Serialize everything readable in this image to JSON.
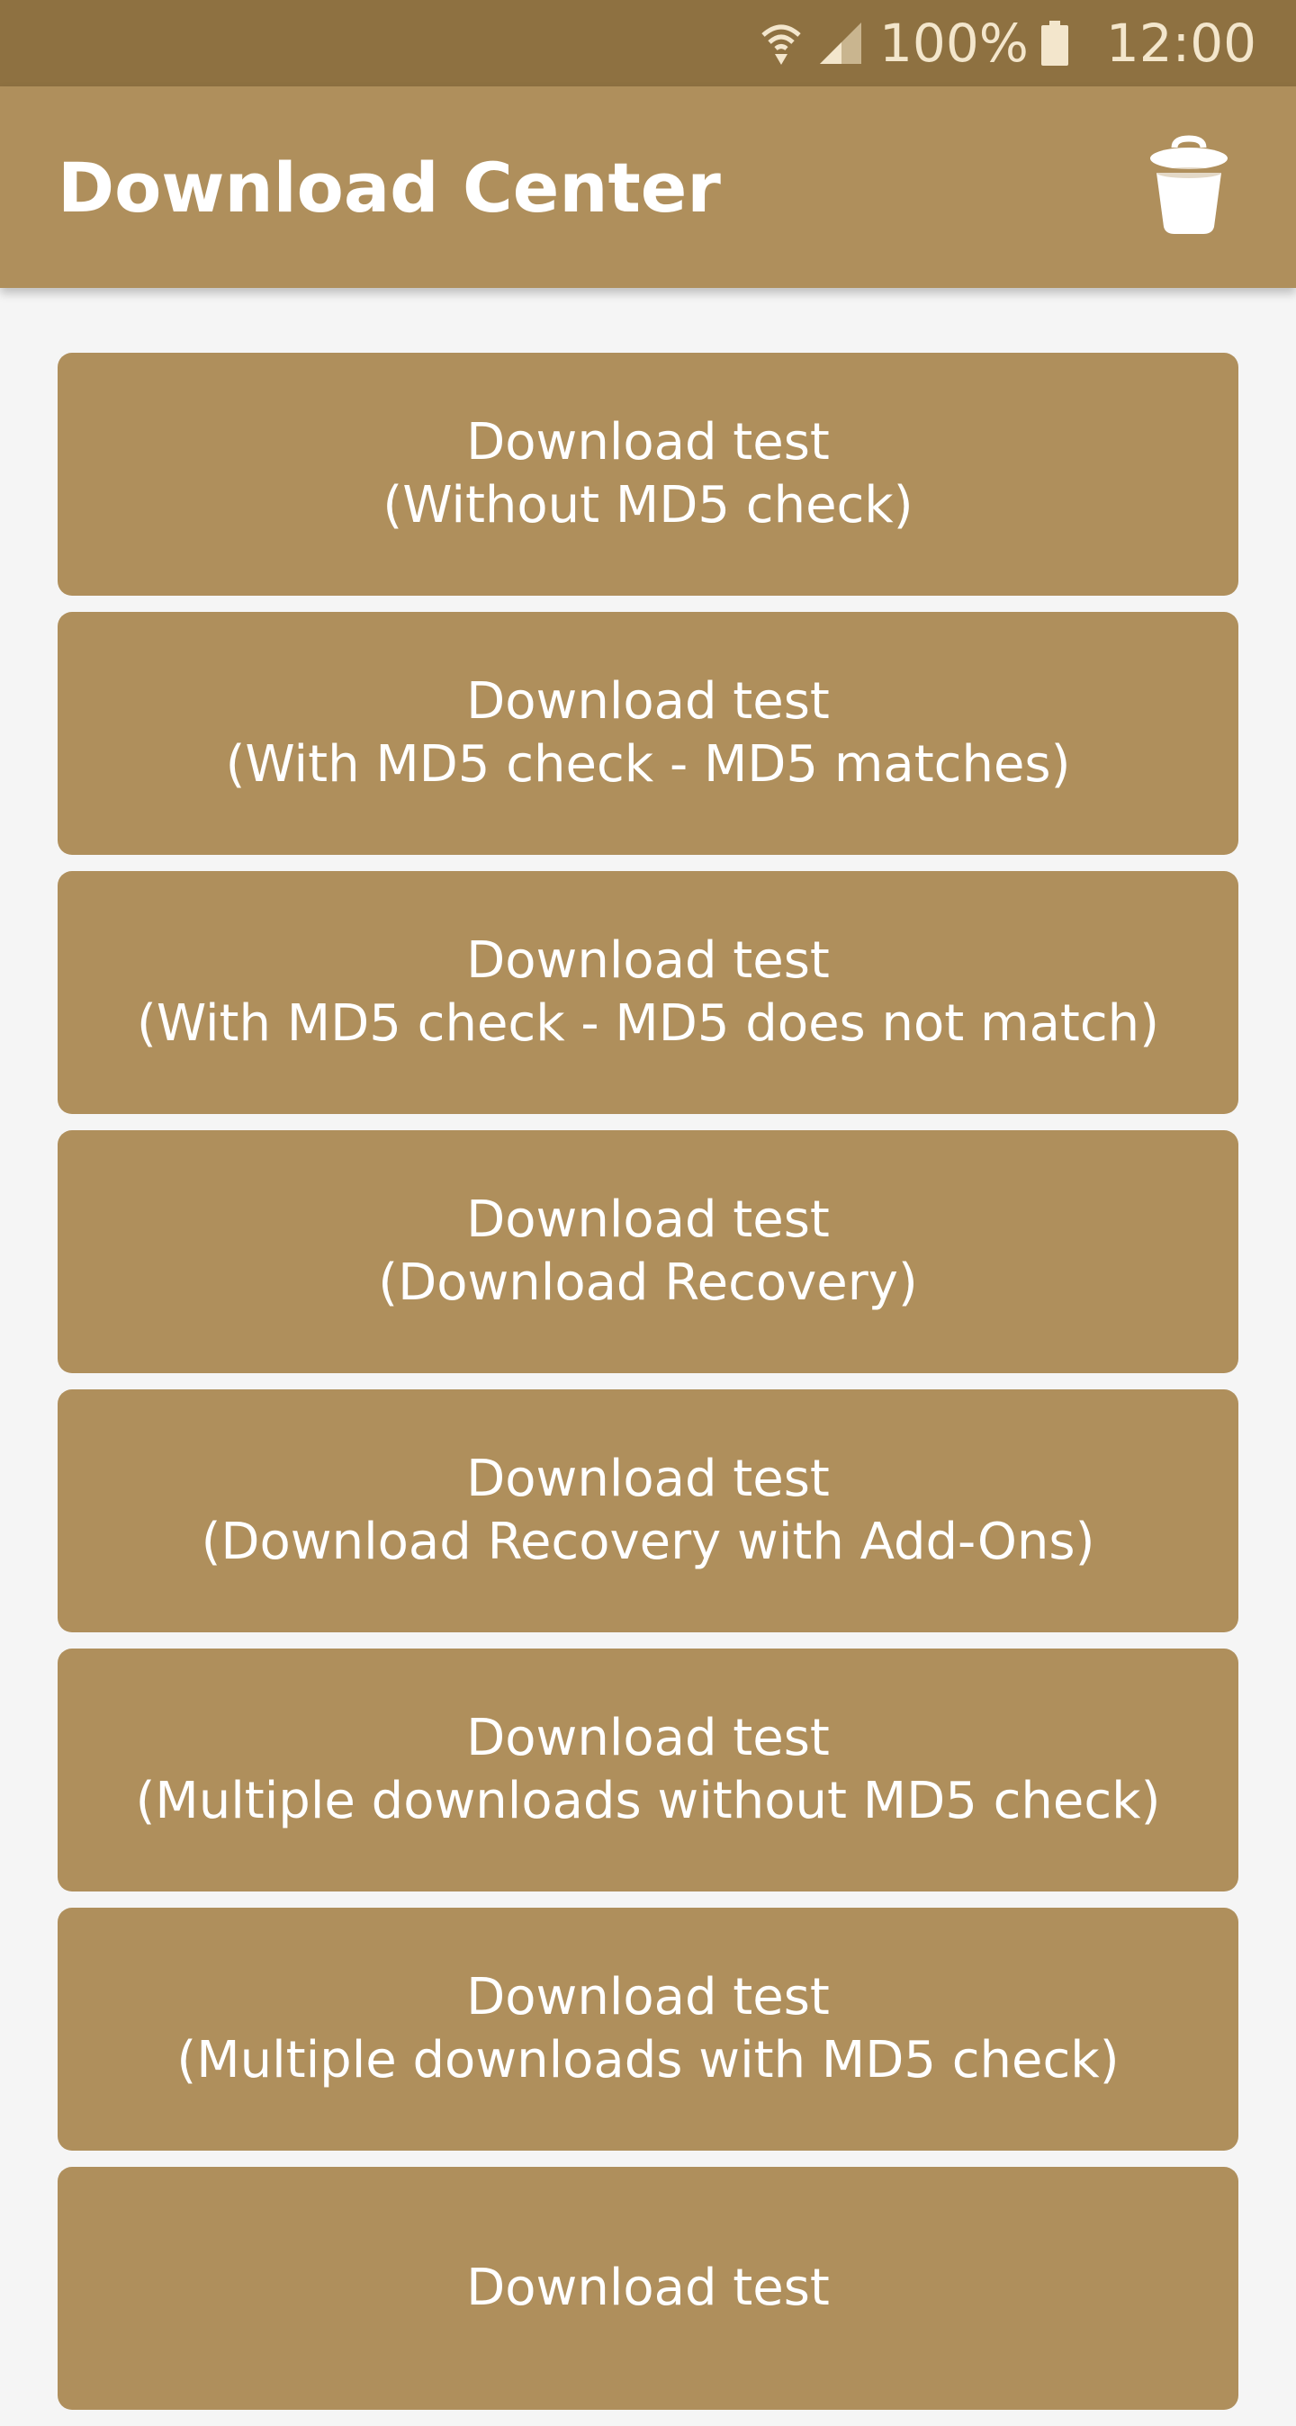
{
  "status_bar": {
    "wifi_icon": "wifi-icon",
    "signal_icon": "signal-icon",
    "battery_percent": "100%",
    "battery_icon": "battery-icon",
    "time": "12:00"
  },
  "app_bar": {
    "title": "Download Center",
    "action_icon": "trash-icon"
  },
  "buttons": [
    {
      "line1": "Download test",
      "line2": "(Without MD5 check)"
    },
    {
      "line1": "Download test",
      "line2": "(With MD5 check - MD5 matches)"
    },
    {
      "line1": "Download test",
      "line2": "(With MD5 check - MD5 does not match)"
    },
    {
      "line1": "Download test",
      "line2": "(Download Recovery)"
    },
    {
      "line1": "Download test",
      "line2": "(Download Recovery with Add-Ons)"
    },
    {
      "line1": "Download test",
      "line2": "(Multiple downloads without MD5 check)"
    },
    {
      "line1": "Download test",
      "line2": "(Multiple downloads with MD5 check)"
    },
    {
      "line1": "Download test",
      "line2": ""
    }
  ],
  "colors": {
    "status_bar": "#8e7141",
    "primary": "#af8f5c",
    "background": "#f5f5f5",
    "text_on_primary": "#ffffff"
  }
}
